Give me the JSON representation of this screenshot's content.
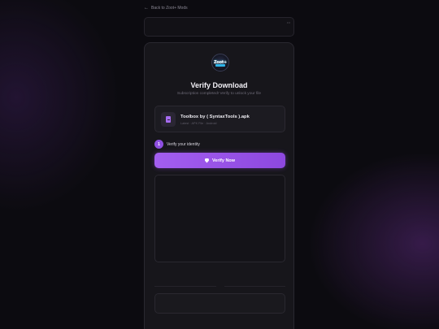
{
  "nav": {
    "back_label": "Back to Zoot+ Mods",
    "back_icon": "arrow-left-icon"
  },
  "top_bar": {
    "label": "•••"
  },
  "header": {
    "logo_text": "Zoot+",
    "title": "Verify Download",
    "subtitle": "Subscription completed! Verify to unlock your file"
  },
  "file": {
    "icon": "file-icon",
    "name": "Toolbox by ( SyntaxTools ).apk",
    "meta": "Latest · APK File · Android"
  },
  "step": {
    "number": "1",
    "label": "Verify your identity"
  },
  "verify_button": {
    "label": "Verify Now",
    "icon": "shield-icon"
  },
  "frame": {
    "corner_label": ""
  },
  "divider": {
    "text": ""
  },
  "bottom_box": {
    "corner_label": ""
  },
  "colors": {
    "accent": "#9b57ea",
    "background": "#0c0b10",
    "card": "#17161b"
  }
}
